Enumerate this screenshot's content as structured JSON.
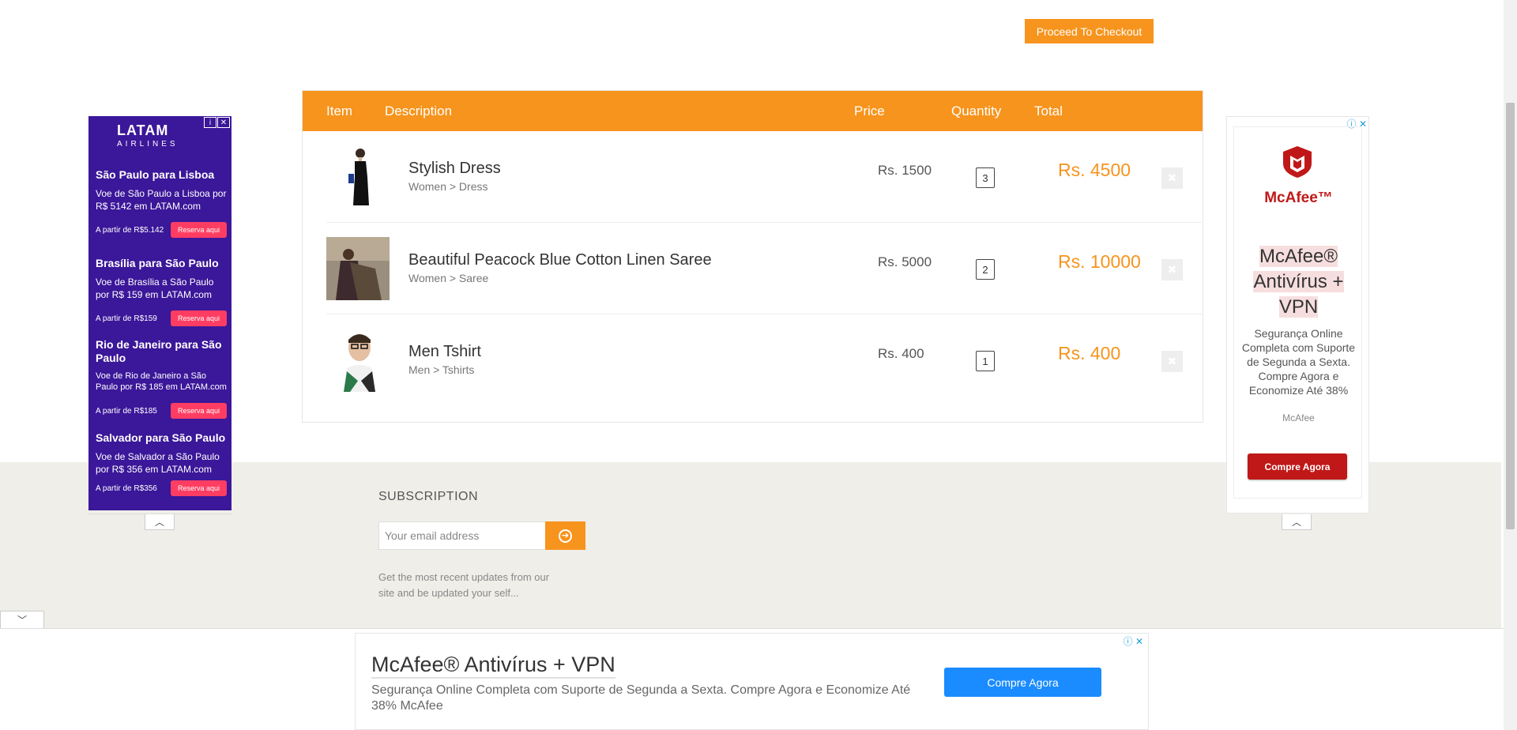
{
  "checkout": {
    "label": "Proceed To Checkout"
  },
  "cart": {
    "headers": {
      "item": "Item",
      "description": "Description",
      "price": "Price",
      "quantity": "Quantity",
      "total": "Total"
    },
    "items": [
      {
        "name": "Stylish Dress",
        "category": "Women > Dress",
        "price": "Rs. 1500",
        "quantity": "3",
        "total": "Rs. 4500",
        "thumb": "dress-photo"
      },
      {
        "name": "Beautiful Peacock Blue Cotton Linen Saree",
        "category": "Women > Saree",
        "price": "Rs. 5000",
        "quantity": "2",
        "total": "Rs. 10000",
        "thumb": "saree-photo"
      },
      {
        "name": "Men Tshirt",
        "category": "Men > Tshirts",
        "price": "Rs. 400",
        "quantity": "1",
        "total": "Rs. 400",
        "thumb": "tshirt-photo"
      }
    ],
    "remove_icon": "close-icon"
  },
  "subscription": {
    "title": "SUBSCRIPTION",
    "placeholder": "Your email address",
    "text": "Get the most recent updates from our site and be updated your self..."
  },
  "latam_ad": {
    "logo": "LATAM",
    "logo_sub": "AIRLINES",
    "offers": [
      {
        "title": "São Paulo para Lisboa",
        "text": "Voe de São Paulo a Lisboa por R$ 5142 em LATAM.com",
        "price": "A partir de R$5.142",
        "cta": "Reserva aqui"
      },
      {
        "title": "Brasília para São Paulo",
        "text": "Voe de Brasília a São Paulo por R$ 159 em LATAM.com",
        "price": "A partir de R$159",
        "cta": "Reserva aqui"
      },
      {
        "title": "Rio de Janeiro para São Paulo",
        "text": "Voe de Rio de Janeiro a São Paulo por R$ 185 em LATAM.com",
        "price": "A partir de R$185",
        "cta": "Reserva aqui"
      },
      {
        "title": "Salvador para São Paulo",
        "text": "Voe de Salvador a São Paulo por R$ 356 em LATAM.com",
        "price": "A partir de R$356",
        "cta": "Reserva aqui"
      }
    ]
  },
  "mcafee_side_ad": {
    "brand": "McAfee™",
    "headline_1": "McAfee®",
    "headline_2": "Antivírus +",
    "headline_3": "VPN",
    "body": "Segurança Online Completa com Suporte de Segunda a Sexta. Compre Agora e Economize Até 38%",
    "source": "McAfee",
    "cta": "Compre Agora"
  },
  "mcafee_banner": {
    "title": "McAfee® Antivírus + VPN",
    "desc": "Segurança Online Completa com Suporte de Segunda a Sexta. Compre Agora e Economize Até 38% McAfee",
    "cta": "Compre Agora"
  },
  "colors": {
    "accent": "#f7941d",
    "latam": "#3b1799",
    "mcafee_red": "#c01818",
    "banner_blue": "#1a8cff"
  }
}
